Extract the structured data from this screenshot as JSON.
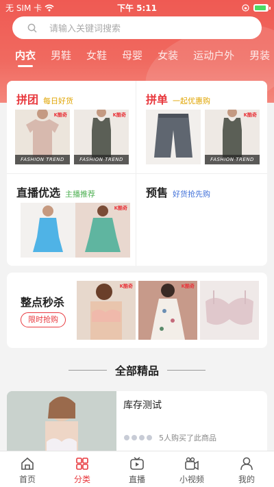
{
  "status_bar": {
    "carrier": "无 SIM 卡",
    "time": "下午 5:11"
  },
  "search": {
    "placeholder": "请输入关键词搜索"
  },
  "category_tabs": [
    {
      "label": "内衣",
      "active": true
    },
    {
      "label": "男鞋"
    },
    {
      "label": "女鞋"
    },
    {
      "label": "母婴"
    },
    {
      "label": "女装"
    },
    {
      "label": "运动户外"
    },
    {
      "label": "男装"
    }
  ],
  "promo": {
    "group_buy": {
      "title": "拼团",
      "subtitle": "每日好货"
    },
    "combo": {
      "title": "拼单",
      "subtitle": "一起优惠购"
    },
    "live": {
      "title": "直播优选",
      "subtitle": "主播推荐"
    },
    "presale": {
      "title": "预售",
      "subtitle": "好货抢先购"
    },
    "banner_text": "FASHION TREND",
    "brand_tag": "K酷奇"
  },
  "flash_sale": {
    "title": "整点秒杀",
    "button": "限时抢购"
  },
  "section": {
    "title": "全部精品"
  },
  "product": {
    "name": "库存测试",
    "buyers_text": "5人购买了此商品"
  },
  "tabbar": [
    {
      "label": "首页",
      "icon": "home-icon"
    },
    {
      "label": "分类",
      "icon": "category-icon",
      "active": true
    },
    {
      "label": "直播",
      "icon": "live-tv-icon"
    },
    {
      "label": "小视频",
      "icon": "video-camera-icon"
    },
    {
      "label": "我的",
      "icon": "person-icon"
    }
  ],
  "colors": {
    "brand_red": "#e8383d",
    "hero": "#ef5a53"
  }
}
